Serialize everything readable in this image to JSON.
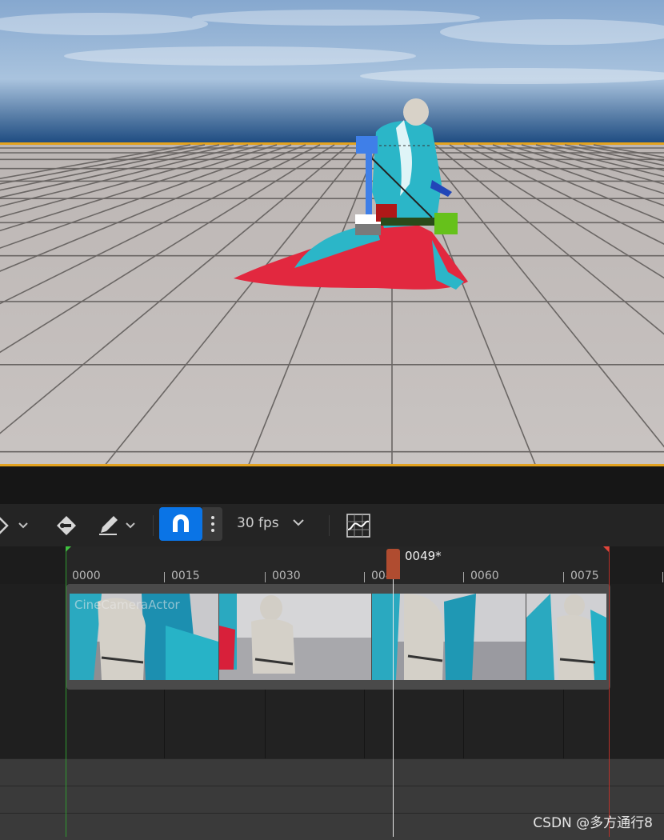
{
  "viewport": {
    "sky_top": "#8fb2d8",
    "sky_horizon": "#1f4e86",
    "floor_color": "#b3adab",
    "selection_outline": "#f5a623"
  },
  "toolbar": {
    "fps_label": "30 fps",
    "snap_color": "#0a74e6"
  },
  "timeline": {
    "playhead_label": "0049*",
    "ticks": [
      "0000",
      "0015",
      "0030",
      "0045",
      "0060",
      "0075"
    ],
    "section_label": "CineCameraActor",
    "start_color": "#3fc23f",
    "end_color": "#e0453a"
  },
  "watermark": "CSDN @多方通行8"
}
